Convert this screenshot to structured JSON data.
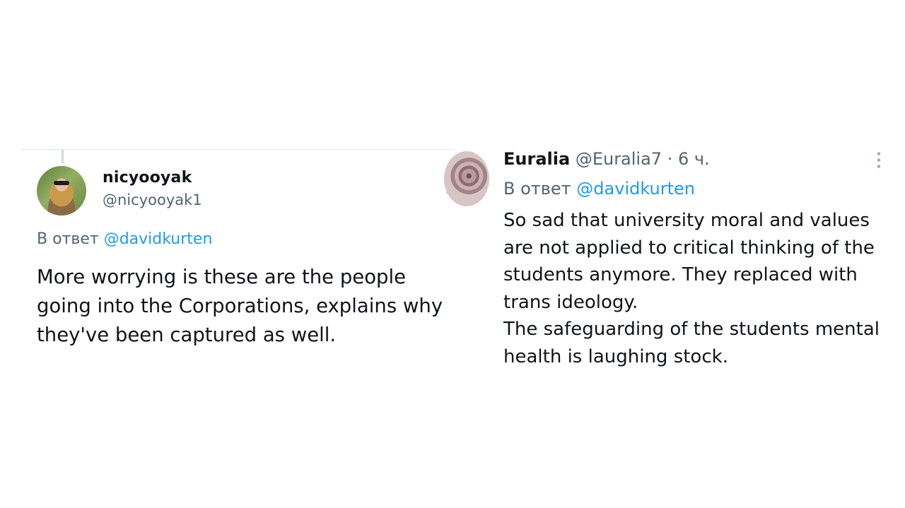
{
  "left_tweet": {
    "name": "nicyooyak",
    "handle": "@nicyooyak1",
    "reply_prefix": "В ответ",
    "reply_to": "@davidkurten",
    "text": "More worrying is these are the people going into the Corporations, explains why they've been captured as well.",
    "avatar_icon": "user-avatar-photo"
  },
  "right_tweet": {
    "name": "Euralia",
    "handle_time": "@Euralia7 · 6 ч.",
    "reply_prefix": "В ответ",
    "reply_to": "@davidkurten",
    "text": "So sad that university moral and values are not applied to critical thinking of the students anymore. They replaced with trans ideology.\nThe  safeguarding of the students mental health is laughing stock.",
    "avatar_icon": "rose-avatar",
    "more_icon": "more-options-icon"
  },
  "colors": {
    "text": "#0f1419",
    "secondary": "#536471",
    "mention": "#1d9bf0",
    "divider": "#dfe3e6"
  }
}
